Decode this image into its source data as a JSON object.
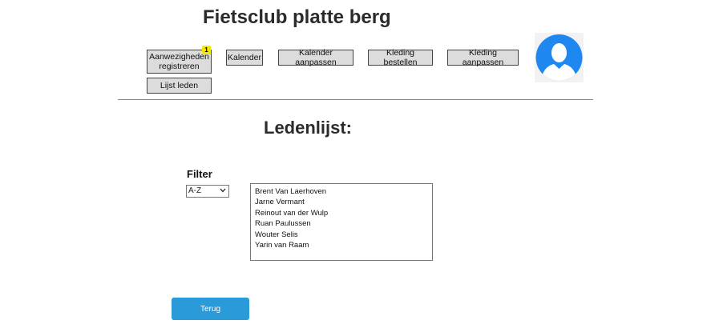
{
  "app": {
    "title": "Fietsclub platte berg"
  },
  "nav": {
    "attendance": {
      "label": "Aanwezigheden registreren",
      "badge": "1"
    },
    "calendar": {
      "label": "Kalender"
    },
    "calendar_edit": {
      "label": "Kalender aanpassen"
    },
    "order_clothing": {
      "label": "Kleding bestellen"
    },
    "edit_clothing": {
      "label": "Kleding aanpassen"
    },
    "member_list": {
      "label": "Lijst leden"
    }
  },
  "avatar": {
    "icon": "user-avatar-icon",
    "color": "#1e88f0"
  },
  "main": {
    "heading": "Ledenlijst:",
    "filter": {
      "label": "Filter",
      "selected": "A-Z"
    },
    "members": [
      "Brent Van Laerhoven",
      "Jarne Vermant",
      "Reinout van der Wulp",
      "Ruan Paulussen",
      "Wouter Selis",
      "Yarin van Raam"
    ],
    "back_button": "Terug"
  },
  "colors": {
    "accent": "#2a9ad8",
    "badge": "#f5e800",
    "nav_button_bg": "#dcdcdc"
  }
}
